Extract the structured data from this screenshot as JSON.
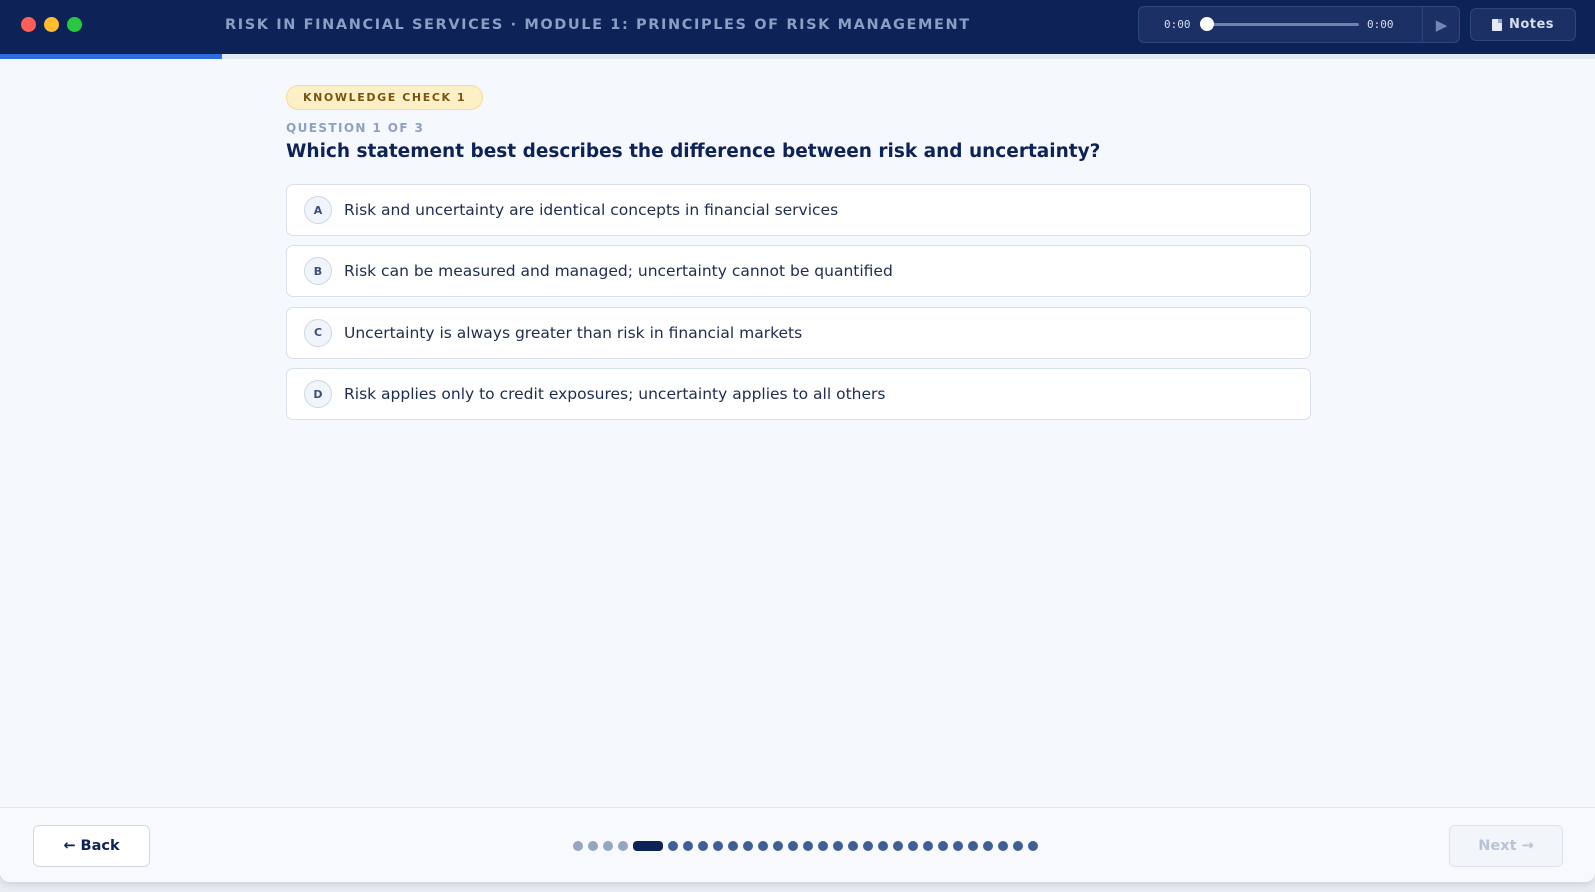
{
  "header": {
    "course_title": "RISK IN FINANCIAL SERVICES · MODULE 1: PRINCIPLES OF RISK MANAGEMENT",
    "audio": {
      "current_time": "0:00",
      "duration": "0:00",
      "progress": 0,
      "play_icon": "play-icon"
    },
    "notes_label": "Notes"
  },
  "course_progress": 0.139,
  "question": {
    "badge": "KNOWLEDGE CHECK 1",
    "counter": "QUESTION 1 OF 3",
    "text": "Which statement best describes the difference between risk and uncertainty?",
    "options": [
      {
        "letter": "A",
        "text": "Risk and uncertainty are identical concepts in financial services"
      },
      {
        "letter": "B",
        "text": "Risk can be measured and managed; uncertainty cannot be quantified"
      },
      {
        "letter": "C",
        "text": "Uncertainty is always greater than risk in financial markets"
      },
      {
        "letter": "D",
        "text": "Risk applies only to credit exposures; uncertainty applies to all others"
      }
    ]
  },
  "footer": {
    "back_label": "← Back",
    "next_label": "Next →",
    "slides": {
      "total": 30,
      "current_index": 4
    }
  },
  "colors": {
    "header_bg": "#0d2257",
    "accent": "#2d6de0",
    "badge_bg": "#fdefc6",
    "badge_text": "#7a5511"
  }
}
